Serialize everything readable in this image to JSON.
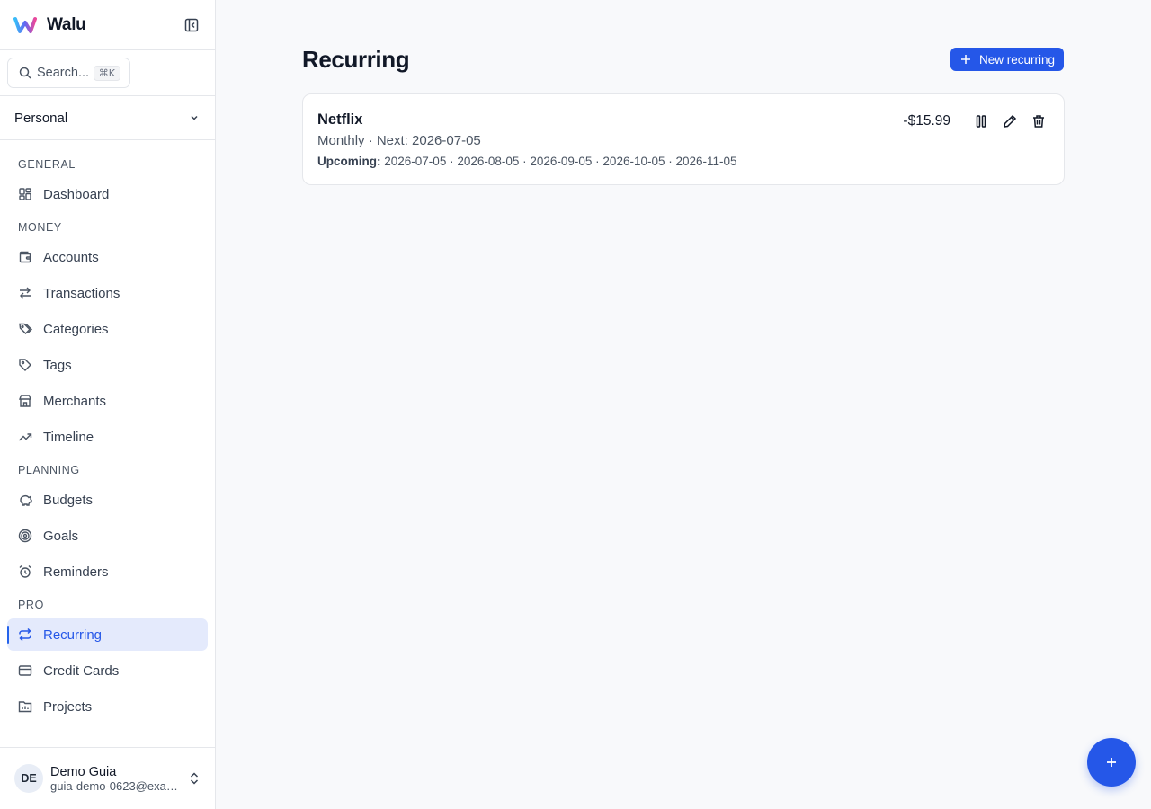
{
  "brand": {
    "name": "Walu"
  },
  "search": {
    "placeholder": "Search...",
    "shortcut": "⌘K"
  },
  "workspace": {
    "label": "Personal"
  },
  "nav": {
    "sections": [
      {
        "title": "GENERAL",
        "items": [
          {
            "label": "Dashboard",
            "icon": "dashboard-icon"
          }
        ]
      },
      {
        "title": "MONEY",
        "items": [
          {
            "label": "Accounts",
            "icon": "wallet-icon"
          },
          {
            "label": "Transactions",
            "icon": "arrows-swap-icon"
          },
          {
            "label": "Categories",
            "icon": "tags-icon"
          },
          {
            "label": "Tags",
            "icon": "tag-icon"
          },
          {
            "label": "Merchants",
            "icon": "store-icon"
          },
          {
            "label": "Timeline",
            "icon": "trending-up-icon"
          }
        ]
      },
      {
        "title": "PLANNING",
        "items": [
          {
            "label": "Budgets",
            "icon": "piggy-bank-icon"
          },
          {
            "label": "Goals",
            "icon": "target-icon"
          },
          {
            "label": "Reminders",
            "icon": "alarm-clock-icon"
          }
        ]
      },
      {
        "title": "PRO",
        "items": [
          {
            "label": "Recurring",
            "icon": "repeat-icon",
            "active": true
          },
          {
            "label": "Credit Cards",
            "icon": "credit-card-icon"
          },
          {
            "label": "Projects",
            "icon": "folder-chart-icon"
          }
        ]
      }
    ]
  },
  "user": {
    "initials": "DE",
    "name": "Demo Guia",
    "email": "guia-demo-0623@example.com"
  },
  "page": {
    "title": "Recurring",
    "new_button": "New recurring"
  },
  "recurring": [
    {
      "name": "Netflix",
      "frequency_line": "Monthly · Next: 2026-07-05",
      "upcoming_label": "Upcoming:",
      "upcoming": "2026-07-05 · 2026-08-05 · 2026-09-05 · 2026-10-05 · 2026-11-05",
      "amount": "-$15.99"
    }
  ],
  "colors": {
    "accent": "#2557e8",
    "active_bg": "#e4eafc",
    "background": "#f8f9fb"
  }
}
